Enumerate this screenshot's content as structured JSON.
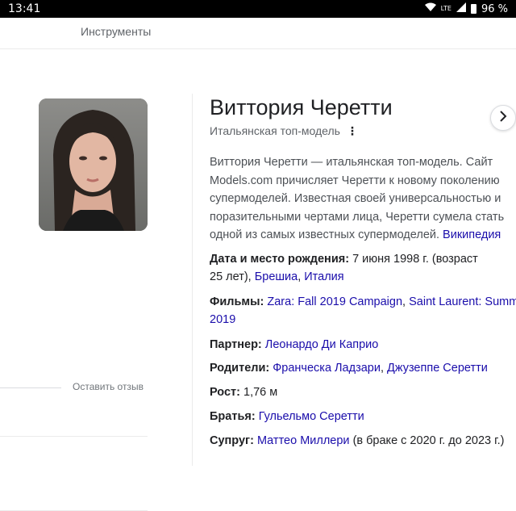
{
  "status_bar": {
    "time": "13:41",
    "network": "LTE",
    "battery": "96 %"
  },
  "header": {
    "tools_label": "Инструменты"
  },
  "entity": {
    "name": "Виттория Черетти",
    "subtitle": "Итальянская топ-модель",
    "description": "Виттория Черетти — итальянская топ-модель. Сайт Models.com причисляет Черетти к новому поколению супермоделей. Известная своей универсальностью и поразительными чертами лица, Черетти сумела стать одной из самых известных супермоделей.",
    "source_link": "Википедия"
  },
  "facts": {
    "birth": {
      "label": "Дата и место рождения:",
      "text1": "7 июня 1998 г. (возраст",
      "text2": "25 лет),",
      "link1": "Брешиа",
      "sep": ",",
      "link2": "Италия"
    },
    "films": {
      "label": "Фильмы:",
      "link1": "Zara: Fall 2019 Campaign",
      "sep": ",",
      "link2": "Saint Laurent: Summer",
      "line2": "2019"
    },
    "partner": {
      "label": "Партнер:",
      "link": "Леонардо Ди Каприо"
    },
    "parents": {
      "label": "Родители:",
      "link1": "Франческа Ладзари",
      "sep": ",",
      "link2": "Джузеппе Серетти"
    },
    "height": {
      "label": "Рост:",
      "value": "1,76 м"
    },
    "siblings": {
      "label": "Братья:",
      "link": "Гульельмо Серетти"
    },
    "spouse": {
      "label": "Супруг:",
      "link": "Маттео Миллери",
      "text": "(в браке с 2020 г. до 2023 г.)"
    }
  },
  "feedback_label": "Оставить отзыв",
  "colors": {
    "link": "#1a0dab",
    "text": "#202124",
    "muted": "#5f6368"
  },
  "icons": [
    "wifi-icon",
    "signal-icon",
    "battery-icon",
    "more-vert-icon",
    "chevron-right-icon"
  ]
}
